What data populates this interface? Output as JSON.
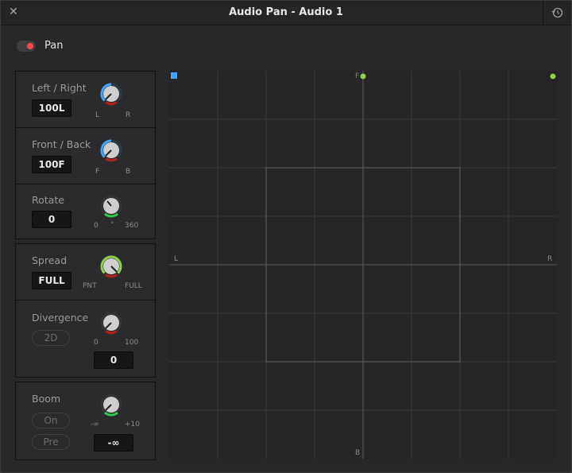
{
  "window": {
    "title": "Audio Pan - Audio 1",
    "close_icon": "close-icon",
    "reset_icon": "history-icon"
  },
  "pan": {
    "label": "Pan",
    "enabled": true,
    "accent": "#ff4a4a"
  },
  "controls": {
    "left_right": {
      "label": "Left / Right",
      "value": "100L",
      "min_label": "L",
      "max_label": "R"
    },
    "front_back": {
      "label": "Front / Back",
      "value": "100F",
      "min_label": "F",
      "max_label": "B"
    },
    "rotate": {
      "label": "Rotate",
      "value": "0",
      "min_label": "0",
      "mid_label": "°",
      "max_label": "360"
    },
    "spread": {
      "label": "Spread",
      "value": "FULL",
      "min_label": "PNT",
      "max_label": "FULL"
    },
    "divergence": {
      "label": "Divergence",
      "mode": "2D",
      "value": "0",
      "min_label": "0",
      "max_label": "100"
    },
    "boom": {
      "label": "Boom",
      "on_label": "On",
      "pre_label": "Pre",
      "value": "-∞",
      "min_label": "-∞",
      "max_label": "+10"
    }
  },
  "pad": {
    "front_label": "F",
    "back_label": "B",
    "left_label": "L",
    "right_label": "R",
    "grid_color": "#3a3a3c",
    "dot_color": "#8fd14f",
    "marker_color": "#3ea6ff"
  }
}
